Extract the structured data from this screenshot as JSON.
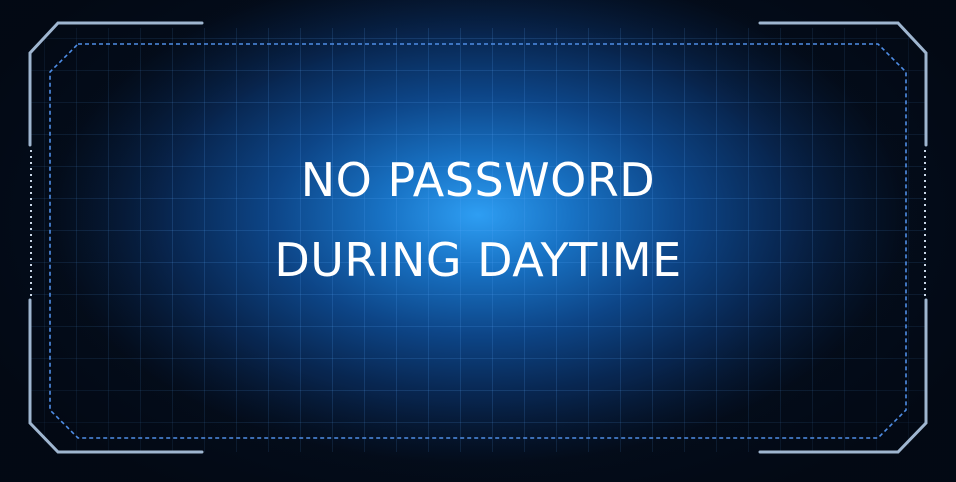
{
  "message": {
    "line1": "NO PASSWORD",
    "line2": "DURING DAYTIME"
  },
  "colors": {
    "background": "#040e1e",
    "glow": "#2e9ef3",
    "frame_outline": "#9fb6d0",
    "dashed_border": "#4f8ee6",
    "text": "#ffffff"
  }
}
